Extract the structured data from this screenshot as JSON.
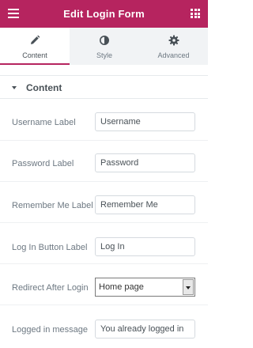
{
  "header": {
    "title": "Edit Login Form",
    "menu_icon": "hamburger-icon",
    "apps_icon": "grid-icon",
    "color": "#b6245f"
  },
  "tabs": [
    {
      "label": "Content",
      "icon": "pencil-icon",
      "active": true
    },
    {
      "label": "Style",
      "icon": "half-circle-icon",
      "active": false
    },
    {
      "label": "Advanced",
      "icon": "gear-icon",
      "active": false
    }
  ],
  "section": {
    "title": "Content",
    "expanded": true
  },
  "fields": {
    "username": {
      "label": "Username Label",
      "value": "Username"
    },
    "password": {
      "label": "Password Label",
      "value": "Password"
    },
    "remember": {
      "label": "Remember Me Label",
      "value": "Remember Me"
    },
    "login_button": {
      "label": "Log In Button Label",
      "value": "Log In"
    },
    "redirect": {
      "label": "Redirect After Login",
      "value": "Home page"
    },
    "logged_in": {
      "label": "Logged in message",
      "value": "You already logged in"
    }
  }
}
